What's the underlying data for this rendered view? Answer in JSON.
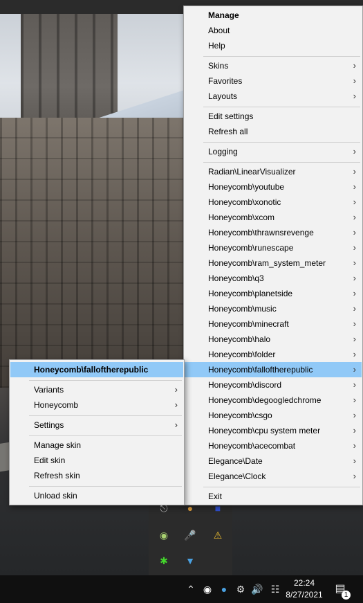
{
  "main_menu": {
    "header": "Manage",
    "items_top": [
      "About",
      "Help"
    ],
    "submenus_1": [
      "Skins",
      "Favorites",
      "Layouts"
    ],
    "items_mid": [
      "Edit settings",
      "Refresh all"
    ],
    "logging": "Logging",
    "skins": [
      "Radian\\LinearVisualizer",
      "Honeycomb\\youtube",
      "Honeycomb\\xonotic",
      "Honeycomb\\xcom",
      "Honeycomb\\thrawnsrevenge",
      "Honeycomb\\runescape",
      "Honeycomb\\ram_system_meter",
      "Honeycomb\\q3",
      "Honeycomb\\planetside",
      "Honeycomb\\music",
      "Honeycomb\\minecraft",
      "Honeycomb\\halo",
      "Honeycomb\\folder",
      "Honeycomb\\falloftherepublic",
      "Honeycomb\\discord",
      "Honeycomb\\degoogledchrome",
      "Honeycomb\\csgo",
      "Honeycomb\\cpu system meter",
      "Honeycomb\\acecombat",
      "Elegance\\Date",
      "Elegance\\Clock"
    ],
    "highlighted_skin": "Honeycomb\\falloftherepublic",
    "exit": "Exit"
  },
  "sub_menu": {
    "header": "Honeycomb\\falloftherepublic",
    "variants": "Variants",
    "config": "Honeycomb",
    "settings": "Settings",
    "manage_skin": "Manage skin",
    "edit_skin": "Edit skin",
    "refresh_skin": "Refresh skin",
    "unload_skin": "Unload skin"
  },
  "taskbar": {
    "time": "22:24",
    "date": "8/27/2021",
    "notification_count": "1"
  },
  "icons": {
    "submenu_arrow": "chevron-right-icon",
    "tray": [
      "show-hidden-icons",
      "discord-icon",
      "app-icon",
      "steam-icon",
      "volume-icon",
      "network-icon",
      "action-center-icon"
    ],
    "flyout": [
      "usb-icon",
      "chrome-icon",
      "app-icon",
      "nvidia-icon",
      "microphone-icon",
      "windows-security-icon",
      "razer-icon",
      "app-icon"
    ]
  },
  "colors": {
    "menu_bg": "#f2f2f2",
    "highlight": "#91c9f7",
    "taskbar": "#101010"
  }
}
